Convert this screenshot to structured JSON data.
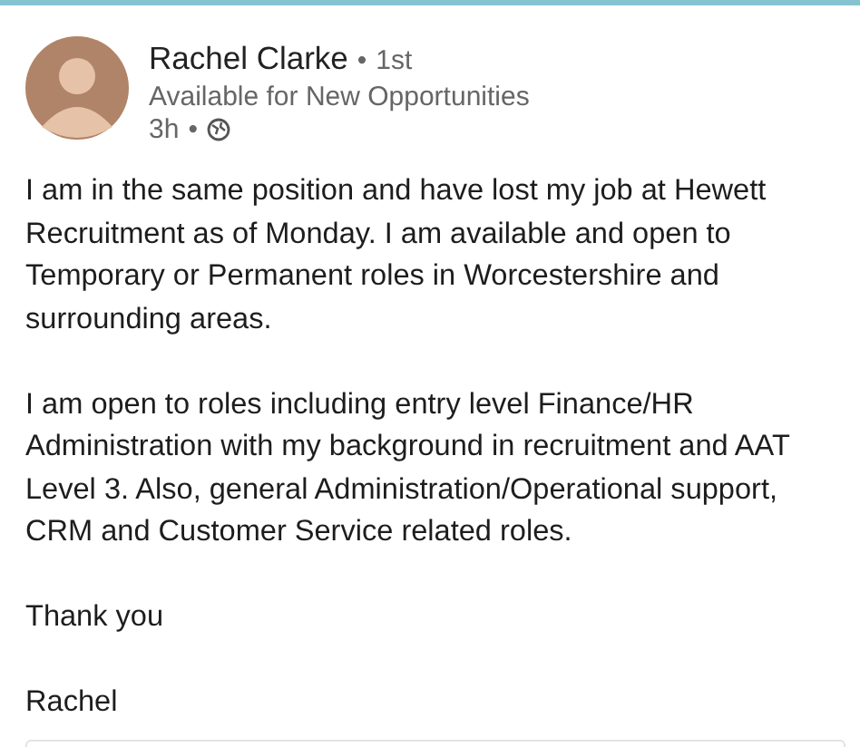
{
  "post": {
    "author": {
      "name": "Rachel Clarke",
      "separator": "•",
      "degree": "1st",
      "headline": "Available for New Opportunities",
      "time": "3h",
      "time_separator": "•"
    },
    "paragraphs": [
      "I am in the same position and have lost my job at Hewett Recruitment as of Monday. I am available and open to Temporary or Permanent roles in Worcestershire and surrounding areas.",
      "I am open to roles including entry level Finance/HR Administration with my background in recruitment and AAT Level 3. Also, general Administration/Operational support, CRM and Customer Service related roles.",
      "Thank you",
      "Rachel"
    ]
  }
}
